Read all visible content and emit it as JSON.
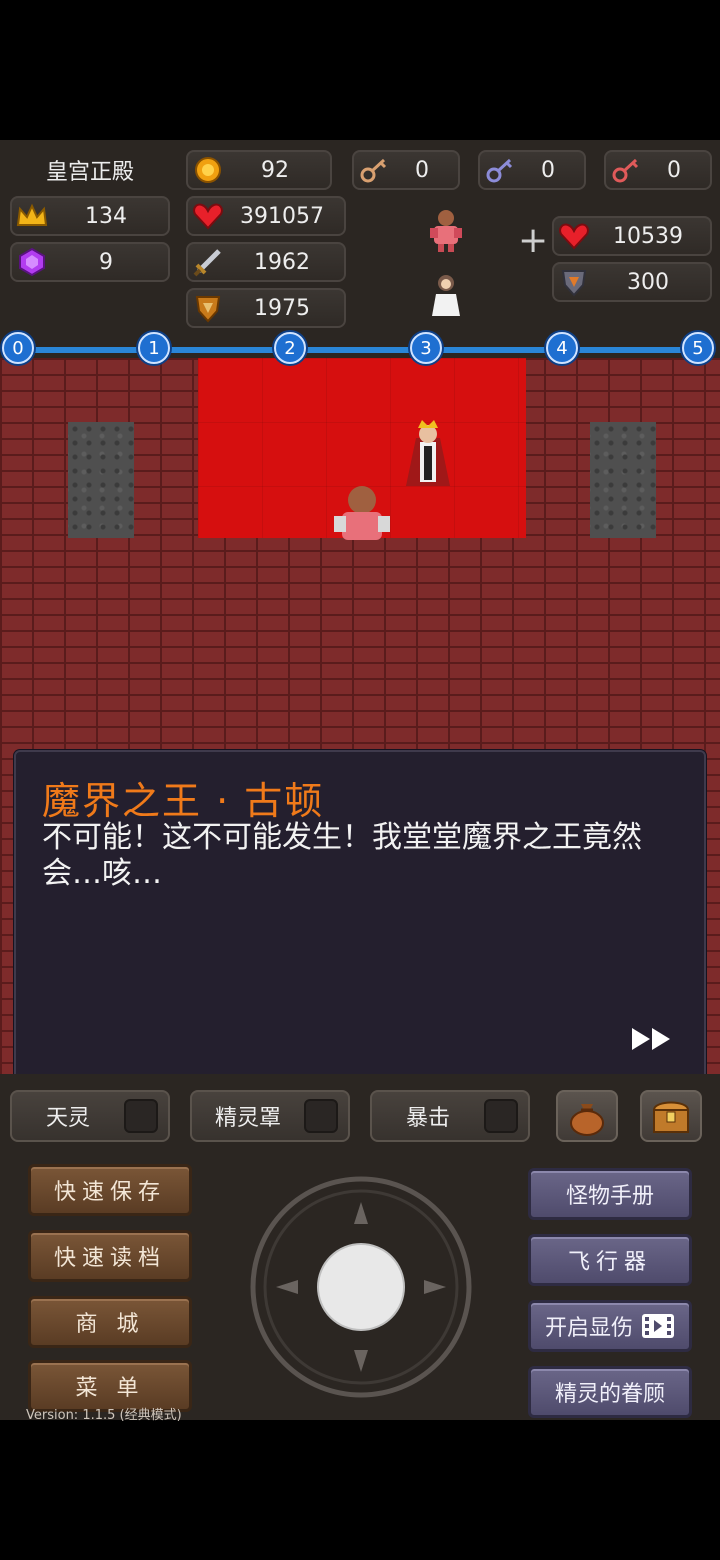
{
  "hud": {
    "floor_name": "皇宫正殿",
    "gold": "92",
    "level": "134",
    "hp": "391057",
    "gems": "9",
    "attack": "1962",
    "defense": "1975",
    "keys": {
      "yellow": "0",
      "blue": "0",
      "red": "0"
    },
    "bonus_hp": "10539",
    "bonus_def": "300",
    "plus_sign": "+"
  },
  "timeline": {
    "nodes": [
      "0",
      "1",
      "2",
      "3",
      "4",
      "5"
    ]
  },
  "dialog": {
    "speaker": "魔界之王 · 古顿",
    "text": "不可能！这不可能发生！我堂堂魔界之王竟然会…咳…"
  },
  "toggles": [
    {
      "label": "天灵"
    },
    {
      "label": "精灵罩"
    },
    {
      "label": "暴击"
    }
  ],
  "left_buttons": [
    "快速保存",
    "快速读档",
    "商 城",
    "菜 单"
  ],
  "right_buttons": [
    "怪物手册",
    "飞行器",
    "开启显伤",
    "精灵的眷顾"
  ],
  "version": "Version: 1.1.5 (经典模式)",
  "colors": {
    "accent_orange": "#f07a1a",
    "timeline_blue": "#1e6fd1",
    "carpet_red": "#d60f0f"
  },
  "icons": {
    "gold": "gold-coin-icon",
    "level": "crown-icon",
    "hp": "heart-icon",
    "gems": "gem-icon",
    "attack": "sword-icon",
    "defense": "shield-icon",
    "bag": "bag-icon",
    "chest": "chest-icon"
  }
}
